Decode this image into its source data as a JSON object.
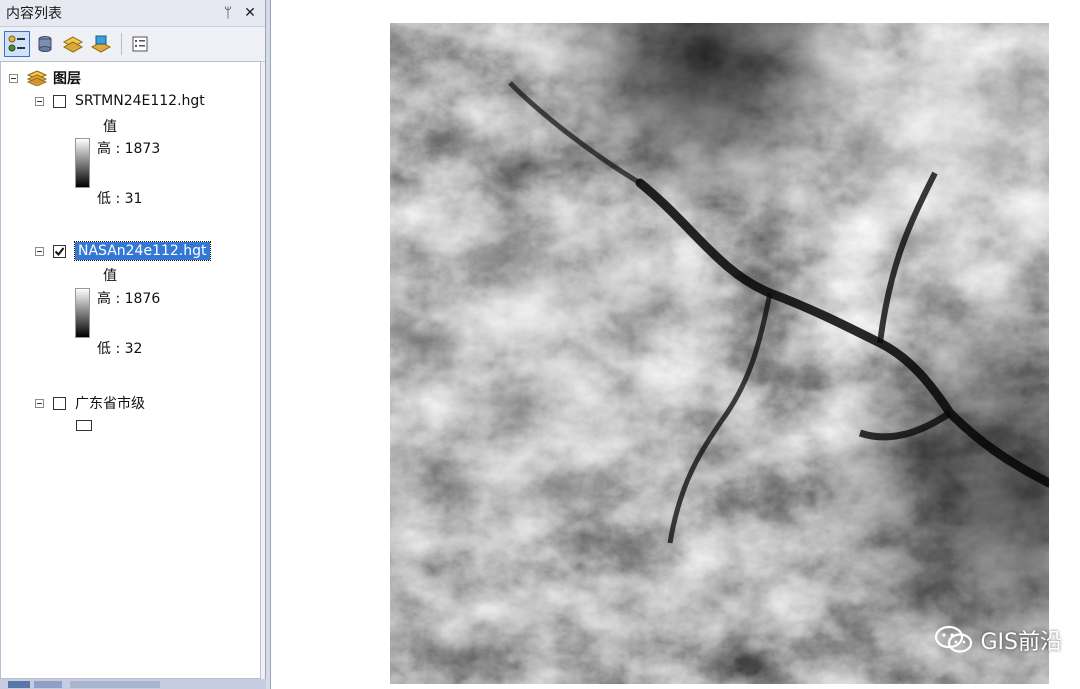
{
  "toc": {
    "title": "内容列表",
    "pin_glyph": "ᛘ",
    "close_glyph": "✕",
    "toolbar": [
      {
        "name": "list-by-drawing-order-icon",
        "active": true
      },
      {
        "name": "list-by-source-icon",
        "active": false
      },
      {
        "name": "list-by-visibility-icon",
        "active": false
      },
      {
        "name": "list-by-selection-icon",
        "active": false
      },
      {
        "name": "options-icon",
        "active": false
      }
    ],
    "root_label": "图层",
    "layers": [
      {
        "name": "SRTMN24E112.hgt",
        "checked": false,
        "selected": false,
        "legend_title": "值",
        "high_label": "高 : 1873",
        "low_label": "低 : 31"
      },
      {
        "name": "NASAn24e112.hgt",
        "checked": true,
        "selected": true,
        "legend_title": "值",
        "high_label": "高 : 1876",
        "low_label": "低 : 32"
      },
      {
        "name": "广东省市级",
        "checked": false,
        "selected": false
      }
    ]
  },
  "colors": {
    "selection": "#3478d6",
    "ramp_high": "#ffffff",
    "ramp_low": "#000000"
  },
  "watermark": {
    "text": "GIS前沿"
  }
}
